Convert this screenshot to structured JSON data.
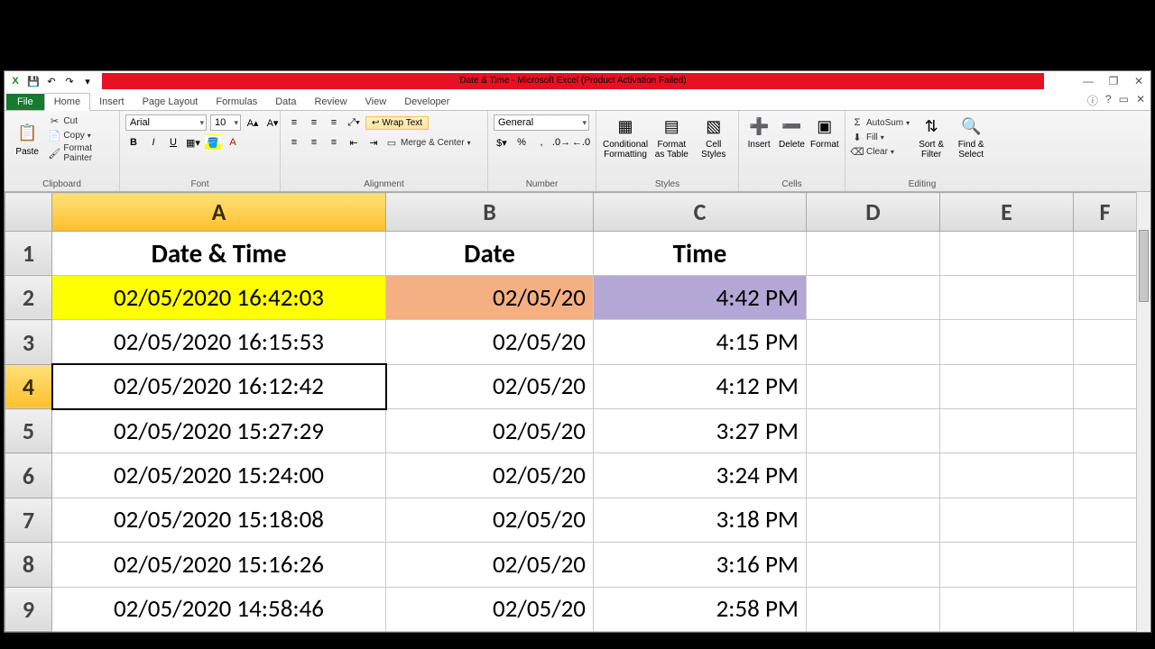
{
  "title": "Date & Time  -  Microsoft Excel (Product Activation Failed)",
  "qat": {
    "save": "💾",
    "undo": "↶",
    "redo": "↷"
  },
  "tabs": {
    "file": "File",
    "items": [
      "Home",
      "Insert",
      "Page Layout",
      "Formulas",
      "Data",
      "Review",
      "View",
      "Developer"
    ],
    "active": 0
  },
  "ribbon": {
    "clipboard": {
      "label": "Clipboard",
      "paste": "Paste",
      "cut": "Cut",
      "copy": "Copy",
      "fmtpainter": "Format Painter"
    },
    "font": {
      "label": "Font",
      "name": "Arial",
      "size": "10",
      "bold": "B",
      "italic": "I",
      "underline": "U"
    },
    "alignment": {
      "label": "Alignment",
      "wrap": "Wrap Text",
      "merge": "Merge & Center"
    },
    "number": {
      "label": "Number",
      "fmt": "General"
    },
    "styles": {
      "label": "Styles",
      "cond": "Conditional Formatting",
      "tbl": "Format as Table",
      "cell": "Cell Styles"
    },
    "cells": {
      "label": "Cells",
      "insert": "Insert",
      "delete": "Delete",
      "format": "Format"
    },
    "editing": {
      "label": "Editing",
      "sum": "AutoSum",
      "fill": "Fill",
      "clear": "Clear",
      "sort": "Sort & Filter",
      "find": "Find & Select"
    }
  },
  "columns": [
    "A",
    "B",
    "C",
    "D",
    "E",
    "F"
  ],
  "headers": {
    "A": "Date & Time",
    "B": "Date",
    "C": "Time"
  },
  "rows": [
    {
      "n": "1"
    },
    {
      "n": "2",
      "A": "02/05/2020 16:42:03",
      "B": "02/05/20",
      "C": "4:42 PM",
      "fillA": "#ffff00",
      "fillB": "#f4b083",
      "fillC": "#b4a7d6"
    },
    {
      "n": "3",
      "A": "02/05/2020 16:15:53",
      "B": "02/05/20",
      "C": "4:15 PM"
    },
    {
      "n": "4",
      "A": "02/05/2020 16:12:42",
      "B": "02/05/20",
      "C": "4:12 PM"
    },
    {
      "n": "5",
      "A": "02/05/2020 15:27:29",
      "B": "02/05/20",
      "C": "3:27 PM"
    },
    {
      "n": "6",
      "A": "02/05/2020 15:24:00",
      "B": "02/05/20",
      "C": "3:24 PM"
    },
    {
      "n": "7",
      "A": "02/05/2020 15:18:08",
      "B": "02/05/20",
      "C": "3:18 PM"
    },
    {
      "n": "8",
      "A": "02/05/2020 15:16:26",
      "B": "02/05/20",
      "C": "3:16 PM"
    },
    {
      "n": "9",
      "A": "02/05/2020 14:58:46",
      "B": "02/05/20",
      "C": "2:58 PM"
    }
  ],
  "active": {
    "row": 4,
    "col": "A"
  }
}
